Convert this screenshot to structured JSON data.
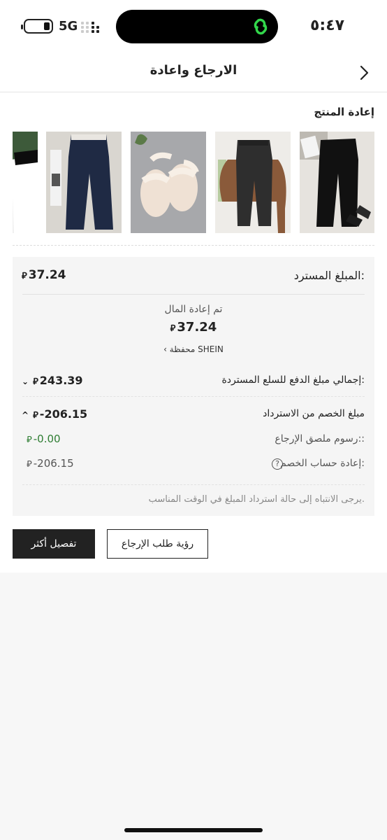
{
  "status_bar": {
    "time": "٥:٤٧",
    "network": "5G"
  },
  "header": {
    "title": "الارجاع واعادة"
  },
  "products": {
    "section_title": "إعادة المنتج",
    "items": [
      {
        "name": "black-pants"
      },
      {
        "name": "grey-jeans"
      },
      {
        "name": "sandals"
      },
      {
        "name": "navy-pants"
      },
      {
        "name": "white-top"
      }
    ]
  },
  "refund": {
    "label": "المبلغ المسترد:",
    "value": "37.24",
    "currency_symbol": "⃁",
    "status": "تم إعادة المال",
    "status_amount": "37.24",
    "wallet": "محفظة SHEIN",
    "total_label": "إجمالي مبلغ الدفع للسلع المستردة:",
    "total_value": "243.39",
    "deduction_label": "مبلغ الخصم من الاسترداد",
    "deduction_value": "-206.15",
    "label_fee_label": "رسوم ملصق الإرجاع::",
    "label_fee_value": "-0.00",
    "return_calc_label": "إعادة حساب الخصم:",
    "return_calc_value": "-206.15",
    "note": "يرجى الانتباه إلى حالة استرداد المبلغ في الوقت المناسب."
  },
  "buttons": {
    "more_details": "تفصيل أكثر",
    "view_return": "رؤية طلب الإرجاع"
  },
  "colors": {
    "green": "#2e7d32",
    "accent": "#222222"
  }
}
